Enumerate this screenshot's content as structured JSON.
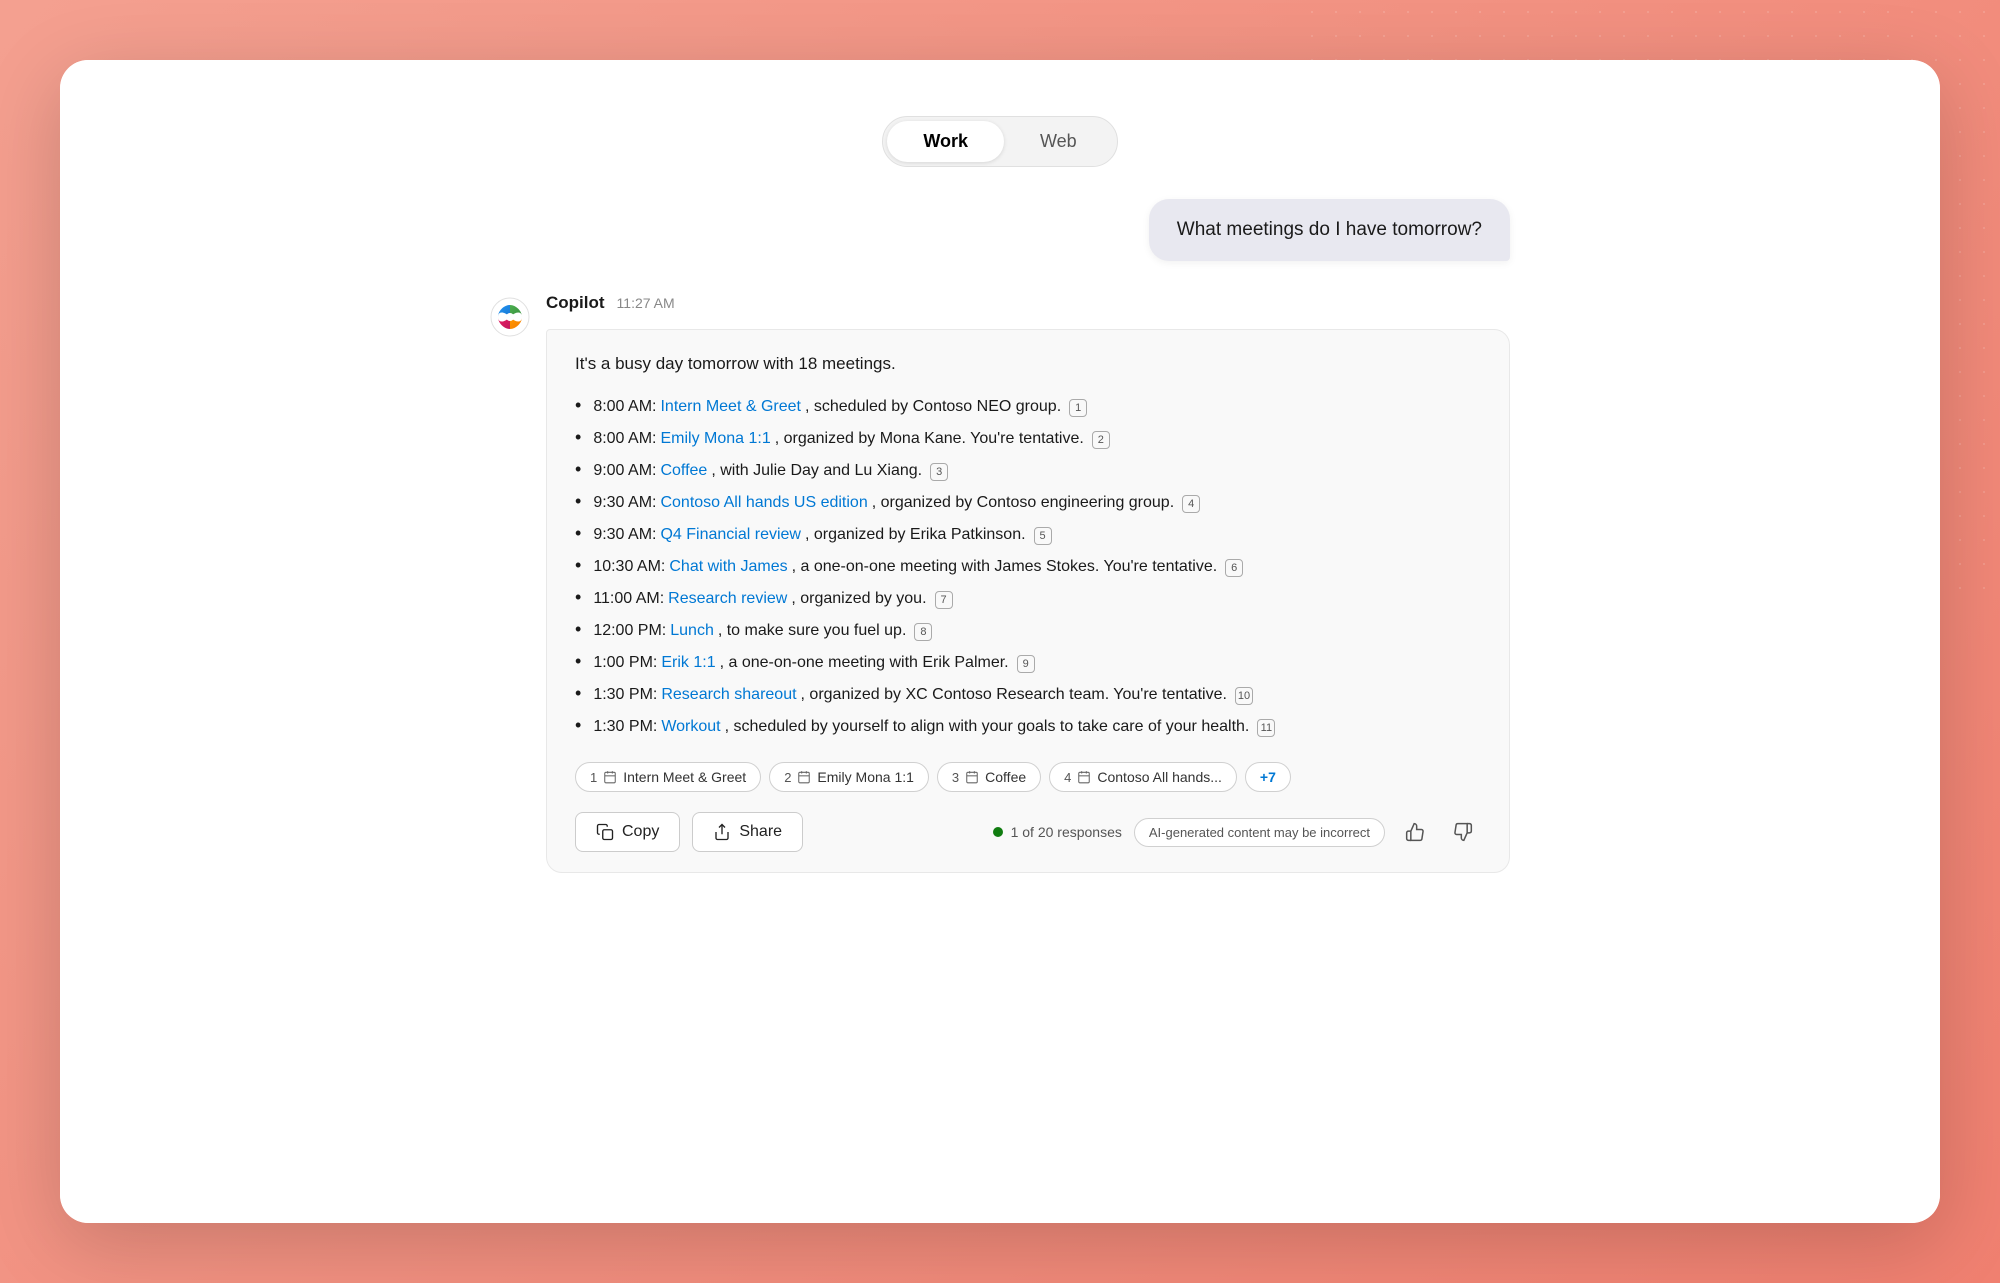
{
  "background": {
    "color": "#f0907a"
  },
  "tabs": {
    "work_label": "Work",
    "web_label": "Web",
    "active": "work"
  },
  "user_message": {
    "text": "What meetings do I have tomorrow?"
  },
  "copilot_response": {
    "sender": "Copilot",
    "time": "11:27 AM",
    "intro": "It's a busy day tomorrow with 18 meetings.",
    "meetings": [
      {
        "time": "8:00 AM",
        "link_text": "Intern Meet & Greet",
        "rest": ", scheduled by Contoso NEO group.",
        "ref": 1
      },
      {
        "time": "8:00 AM",
        "link_text": "Emily Mona 1:1",
        "rest": ", organized by Mona Kane. You're tentative.",
        "ref": 2
      },
      {
        "time": "9:00 AM",
        "link_text": "Coffee",
        "rest": ", with Julie Day and Lu Xiang.",
        "ref": 3
      },
      {
        "time": "9:30 AM",
        "link_text": "Contoso All hands US edition",
        "rest": ", organized by Contoso engineering group.",
        "ref": 4
      },
      {
        "time": "9:30 AM",
        "link_text": "Q4 Financial review",
        "rest": ", organized by Erika Patkinson.",
        "ref": 5
      },
      {
        "time": "10:30 AM",
        "link_text": "Chat with James",
        "rest": ", a one-on-one meeting with James Stokes. You're tentative.",
        "ref": 6
      },
      {
        "time": "11:00 AM",
        "link_text": "Research review",
        "rest": ", organized by you.",
        "ref": 7
      },
      {
        "time": "12:00 PM",
        "link_text": "Lunch",
        "rest": ", to make sure you fuel up.",
        "ref": 8
      },
      {
        "time": "1:00 PM",
        "link_text": "Erik 1:1",
        "rest": ", a one-on-one meeting with Erik Palmer.",
        "ref": 9
      },
      {
        "time": "1:30 PM",
        "link_text": "Research shareout",
        "rest": ", organized by XC Contoso Research team. You're tentative.",
        "ref": 10
      },
      {
        "time": "1:30 PM",
        "link_text": "Workout",
        "rest": ", scheduled by yourself to align with your goals to take care of your health.",
        "ref": 11
      }
    ],
    "citations": [
      {
        "num": 1,
        "label": "Intern Meet & Greet"
      },
      {
        "num": 2,
        "label": "Emily Mona 1:1"
      },
      {
        "num": 3,
        "label": "Coffee"
      },
      {
        "num": 4,
        "label": "Contoso All hands..."
      }
    ],
    "more_label": "+7",
    "copy_label": "Copy",
    "share_label": "Share",
    "response_count": "1 of 20 responses",
    "ai_warning": "AI-generated content may be incorrect"
  }
}
